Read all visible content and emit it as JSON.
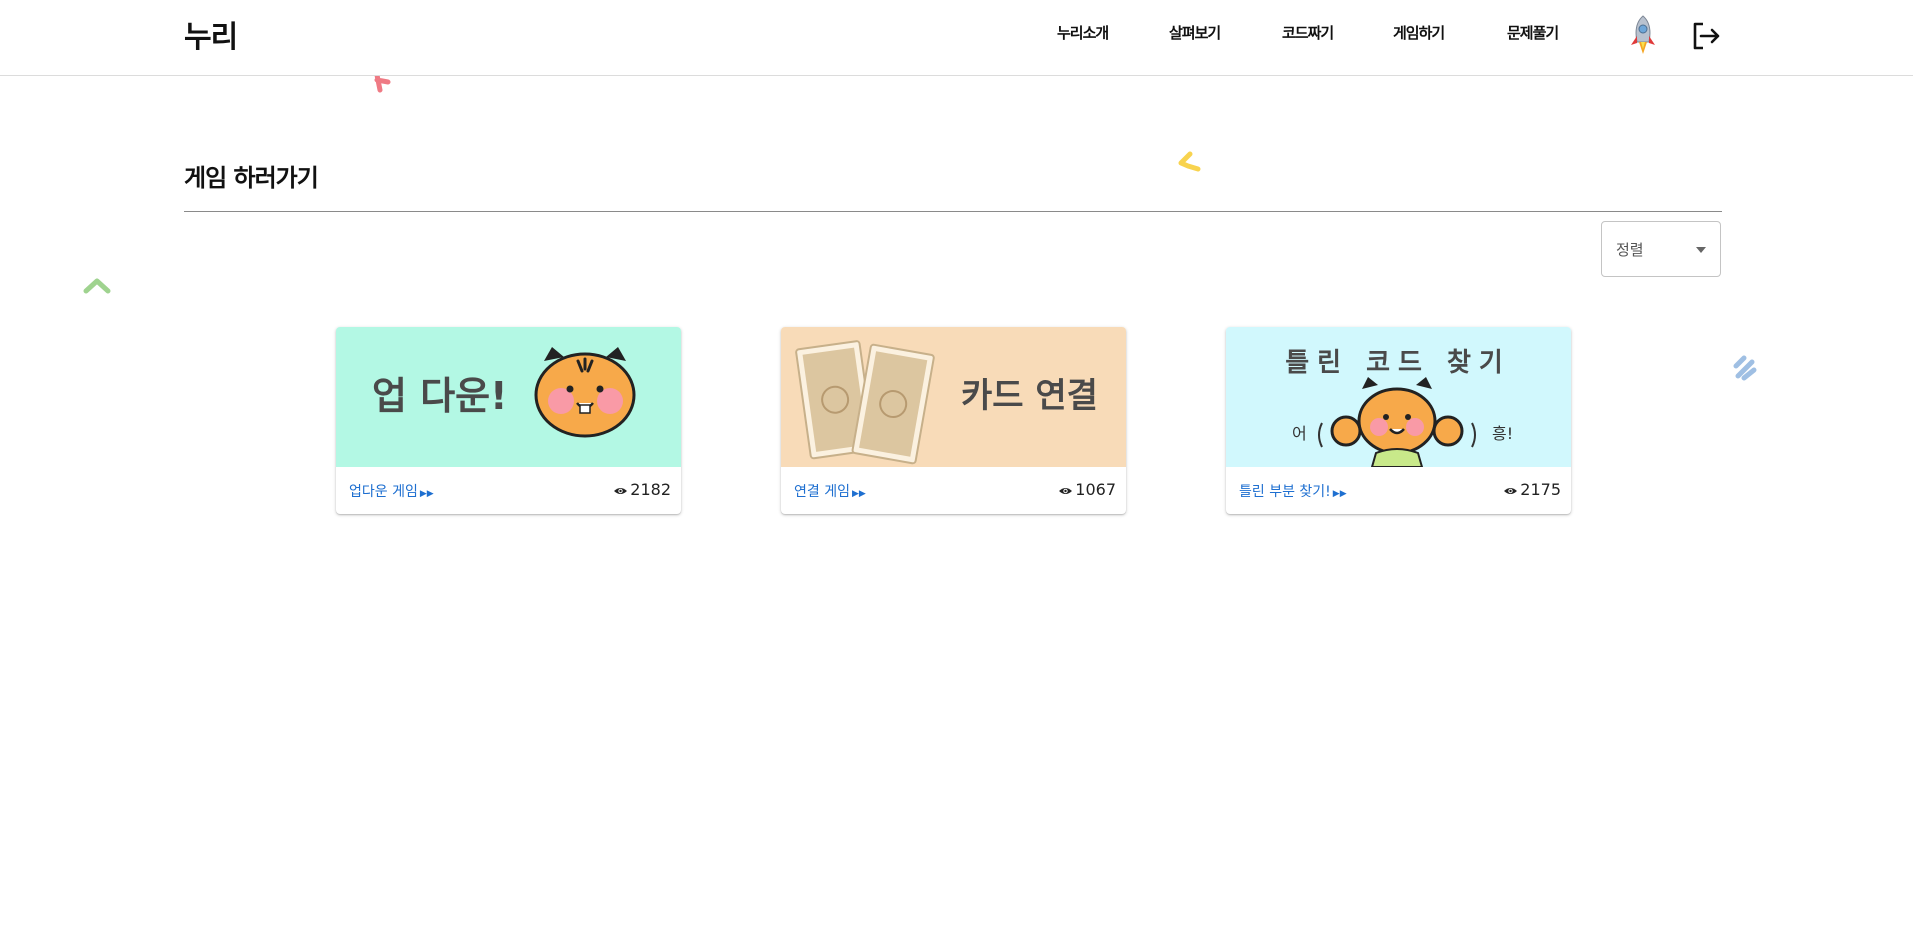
{
  "header": {
    "logo": "누리",
    "nav": [
      "누리소개",
      "살펴보기",
      "코드짜기",
      "게임하기",
      "문제풀기"
    ]
  },
  "page": {
    "title": "게임 하러가기",
    "sort_label": "정렬"
  },
  "cards": [
    {
      "thumb_text": "업 다운!",
      "link": "업다운 게임",
      "views": "2182",
      "bg": "#b3f8e4"
    },
    {
      "thumb_text": "카드 연결",
      "link": "연결 게임",
      "views": "1067",
      "bg": "#f8dbb8"
    },
    {
      "thumb_title": "틀린 코드 찾기",
      "thumb_left": "어",
      "thumb_right": "흥!",
      "link": "틀린 부분 찾기!",
      "views": "2175",
      "bg": "#d1f8fd"
    }
  ],
  "colors": {
    "link": "#1e6fd0",
    "divider": "#8a8a8a",
    "tiger": "#f7a94a",
    "cheek": "#f99aa6"
  },
  "icons": {
    "avatar": "rocket-icon",
    "logout": "logout-icon",
    "views": "eye-icon",
    "more": "fast-forward-icon",
    "sort": "caret-down-icon"
  }
}
